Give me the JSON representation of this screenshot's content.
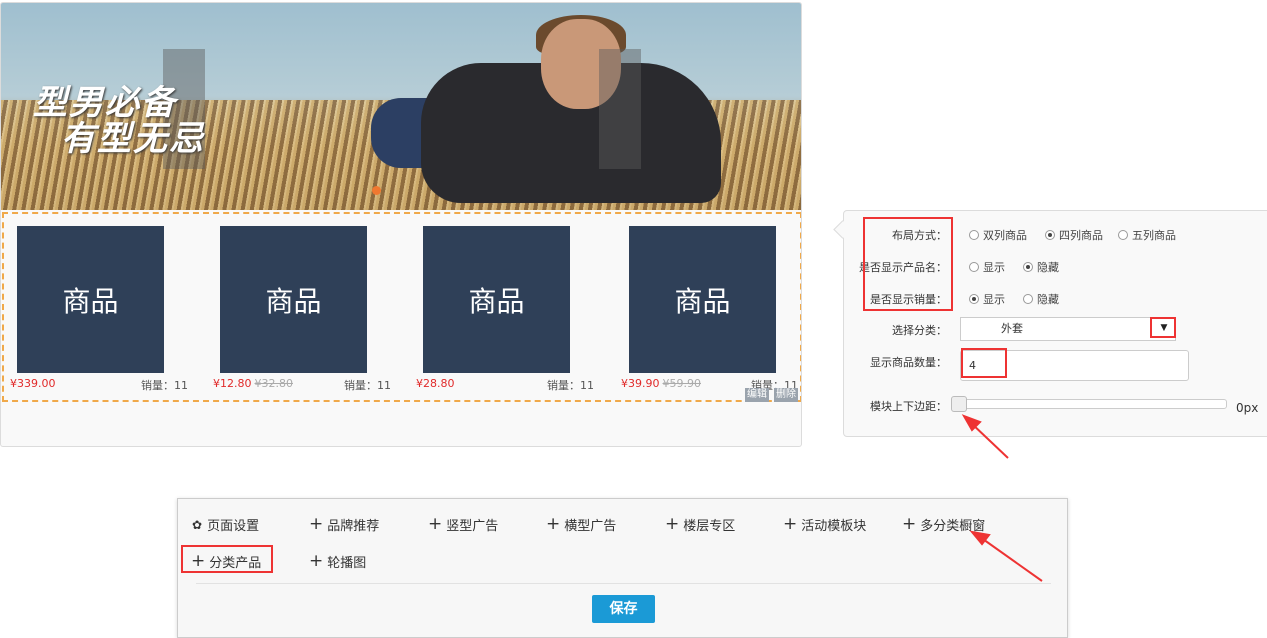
{
  "banner": {
    "caption_line1": "型男必备",
    "caption_line2": "有型无忌"
  },
  "products": [
    {
      "image_label": "商品",
      "price": "¥339.00",
      "old_price": "",
      "sales": "销量：11"
    },
    {
      "image_label": "商品",
      "price": "¥12.80",
      "old_price": "¥32.80",
      "sales": "销量：11"
    },
    {
      "image_label": "商品",
      "price": "¥28.80",
      "old_price": "",
      "sales": "销量：11"
    },
    {
      "image_label": "商品",
      "price": "¥39.90",
      "old_price": "¥59.90",
      "sales": "销量：11"
    }
  ],
  "module_actions": {
    "edit": "编辑",
    "delete": "删除"
  },
  "settings": {
    "layout_label": "布局方式：",
    "layout_options": [
      "双列商品",
      "四列商品",
      "五列商品"
    ],
    "layout_selected": "四列商品",
    "show_name_label": "是否显示产品名：",
    "show_name_options": [
      "显示",
      "隐藏"
    ],
    "show_name_selected": "隐藏",
    "show_sales_label": "是否显示销量：",
    "show_sales_options": [
      "显示",
      "隐藏"
    ],
    "show_sales_selected": "显示",
    "category_label": "选择分类：",
    "category_value": "外套",
    "category_arrow": "▼",
    "count_label": "显示商品数量：",
    "count_value": "4",
    "margin_label": "模块上下边距：",
    "margin_value": "0px",
    "margin_fraction": 0
  },
  "toolbar": {
    "items": [
      {
        "label": "页面设置",
        "icon": "gear-icon"
      },
      {
        "label": "品牌推荐",
        "icon": "plus-icon"
      },
      {
        "label": "竖型广告",
        "icon": "plus-icon"
      },
      {
        "label": "横型广告",
        "icon": "plus-icon"
      },
      {
        "label": "楼层专区",
        "icon": "plus-icon"
      },
      {
        "label": "活动模板块",
        "icon": "plus-icon"
      },
      {
        "label": "多分类橱窗",
        "icon": "plus-icon"
      },
      {
        "label": "分类产品",
        "icon": "plus-icon"
      },
      {
        "label": "轮播图",
        "icon": "plus-icon"
      }
    ],
    "save_label": "保存"
  },
  "colors": {
    "product_tile": "#2f4058",
    "price": "#e12a2a",
    "dashed_border": "#f0a94a",
    "highlight": "#e33333",
    "save_button": "#1b9ad6"
  }
}
